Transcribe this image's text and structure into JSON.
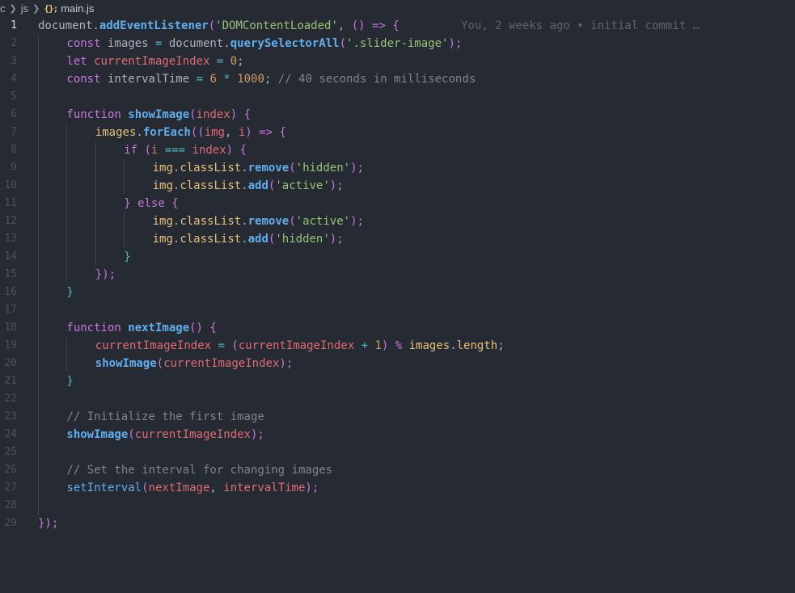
{
  "breadcrumb": {
    "items": [
      "c",
      "js"
    ],
    "file_icon": "{};",
    "file_name": "main.js"
  },
  "blame": "You, 2 weeks ago • initial commit …",
  "current_line": 1,
  "lines": [
    {
      "n": "1",
      "indent": 0,
      "tokens": [
        [
          "document",
          "t-plain"
        ],
        [
          ".",
          "t-plain"
        ],
        [
          "addEventListener",
          "t-fnb"
        ],
        [
          "(",
          "t-paren"
        ],
        [
          "'DOMContentLoaded'",
          "t-str"
        ],
        [
          ", ",
          "t-plain"
        ],
        [
          "() ",
          "t-paren"
        ],
        [
          "=>",
          "t-kw"
        ],
        [
          " {",
          "t-paren"
        ]
      ]
    },
    {
      "n": "2",
      "indent": 1,
      "tokens": [
        [
          "const",
          "t-kw"
        ],
        [
          " images ",
          "t-plain"
        ],
        [
          "=",
          "t-op"
        ],
        [
          " document",
          "t-plain"
        ],
        [
          ".",
          "t-plain"
        ],
        [
          "querySelectorAll",
          "t-fnb"
        ],
        [
          "(",
          "t-paren"
        ],
        [
          "'.slider-image'",
          "t-str"
        ],
        [
          ");",
          "t-paren"
        ]
      ]
    },
    {
      "n": "3",
      "indent": 1,
      "tokens": [
        [
          "let",
          "t-kw"
        ],
        [
          " ",
          "t-plain"
        ],
        [
          "currentImageIndex",
          "t-var"
        ],
        [
          " ",
          "t-plain"
        ],
        [
          "=",
          "t-op"
        ],
        [
          " ",
          "t-plain"
        ],
        [
          "0",
          "t-num"
        ],
        [
          ";",
          "t-plain"
        ]
      ]
    },
    {
      "n": "4",
      "indent": 1,
      "tokens": [
        [
          "const",
          "t-kw"
        ],
        [
          " intervalTime ",
          "t-plain"
        ],
        [
          "=",
          "t-op"
        ],
        [
          " ",
          "t-plain"
        ],
        [
          "6",
          "t-num"
        ],
        [
          " ",
          "t-plain"
        ],
        [
          "*",
          "t-op"
        ],
        [
          " ",
          "t-plain"
        ],
        [
          "1000",
          "t-num"
        ],
        [
          "; ",
          "t-plain"
        ],
        [
          "// 40 seconds in milliseconds",
          "t-com"
        ]
      ]
    },
    {
      "n": "5",
      "indent": 1,
      "tokens": []
    },
    {
      "n": "6",
      "indent": 1,
      "tokens": [
        [
          "function",
          "t-kw"
        ],
        [
          " ",
          "t-plain"
        ],
        [
          "showImage",
          "t-fnb"
        ],
        [
          "(",
          "t-paren"
        ],
        [
          "index",
          "t-var"
        ],
        [
          ") {",
          "t-paren"
        ]
      ]
    },
    {
      "n": "7",
      "indent": 2,
      "tokens": [
        [
          "images",
          "t-prop"
        ],
        [
          ".",
          "t-plain"
        ],
        [
          "forEach",
          "t-fnb"
        ],
        [
          "((",
          "t-paren"
        ],
        [
          "img",
          "t-var"
        ],
        [
          ", ",
          "t-plain"
        ],
        [
          "i",
          "t-var"
        ],
        [
          ") ",
          "t-paren"
        ],
        [
          "=>",
          "t-kw"
        ],
        [
          " {",
          "t-paren"
        ]
      ]
    },
    {
      "n": "8",
      "indent": 3,
      "tokens": [
        [
          "if",
          "t-kw"
        ],
        [
          " (",
          "t-paren"
        ],
        [
          "i",
          "t-var"
        ],
        [
          " ",
          "t-plain"
        ],
        [
          "===",
          "t-op"
        ],
        [
          " ",
          "t-plain"
        ],
        [
          "index",
          "t-var"
        ],
        [
          ") {",
          "t-paren"
        ]
      ]
    },
    {
      "n": "9",
      "indent": 4,
      "tokens": [
        [
          "img",
          "t-prop"
        ],
        [
          ".",
          "t-plain"
        ],
        [
          "classList",
          "t-prop"
        ],
        [
          ".",
          "t-plain"
        ],
        [
          "remove",
          "t-fnb"
        ],
        [
          "(",
          "t-paren"
        ],
        [
          "'hidden'",
          "t-str"
        ],
        [
          ");",
          "t-paren"
        ]
      ]
    },
    {
      "n": "10",
      "indent": 4,
      "tokens": [
        [
          "img",
          "t-prop"
        ],
        [
          ".",
          "t-plain"
        ],
        [
          "classList",
          "t-prop"
        ],
        [
          ".",
          "t-plain"
        ],
        [
          "add",
          "t-fnb"
        ],
        [
          "(",
          "t-paren"
        ],
        [
          "'active'",
          "t-str"
        ],
        [
          ");",
          "t-paren"
        ]
      ]
    },
    {
      "n": "11",
      "indent": 3,
      "tokens": [
        [
          "} ",
          "t-paren"
        ],
        [
          "else",
          "t-kw"
        ],
        [
          " {",
          "t-paren"
        ]
      ]
    },
    {
      "n": "12",
      "indent": 4,
      "tokens": [
        [
          "img",
          "t-prop"
        ],
        [
          ".",
          "t-plain"
        ],
        [
          "classList",
          "t-prop"
        ],
        [
          ".",
          "t-plain"
        ],
        [
          "remove",
          "t-fnb"
        ],
        [
          "(",
          "t-paren"
        ],
        [
          "'active'",
          "t-str"
        ],
        [
          ");",
          "t-paren"
        ]
      ]
    },
    {
      "n": "13",
      "indent": 4,
      "tokens": [
        [
          "img",
          "t-prop"
        ],
        [
          ".",
          "t-plain"
        ],
        [
          "classList",
          "t-prop"
        ],
        [
          ".",
          "t-plain"
        ],
        [
          "add",
          "t-fnb"
        ],
        [
          "(",
          "t-paren"
        ],
        [
          "'hidden'",
          "t-str"
        ],
        [
          ");",
          "t-paren"
        ]
      ]
    },
    {
      "n": "14",
      "indent": 3,
      "tokens": [
        [
          "}",
          "t-op"
        ]
      ]
    },
    {
      "n": "15",
      "indent": 2,
      "tokens": [
        [
          "});",
          "t-paren"
        ]
      ]
    },
    {
      "n": "16",
      "indent": 1,
      "tokens": [
        [
          "}",
          "t-op"
        ]
      ]
    },
    {
      "n": "17",
      "indent": 1,
      "tokens": []
    },
    {
      "n": "18",
      "indent": 1,
      "tokens": [
        [
          "function",
          "t-kw"
        ],
        [
          " ",
          "t-plain"
        ],
        [
          "nextImage",
          "t-fnb"
        ],
        [
          "() {",
          "t-paren"
        ]
      ]
    },
    {
      "n": "19",
      "indent": 2,
      "tokens": [
        [
          "currentImageIndex",
          "t-var"
        ],
        [
          " ",
          "t-plain"
        ],
        [
          "=",
          "t-op"
        ],
        [
          " (",
          "t-paren"
        ],
        [
          "currentImageIndex",
          "t-var"
        ],
        [
          " ",
          "t-plain"
        ],
        [
          "+",
          "t-op"
        ],
        [
          " ",
          "t-plain"
        ],
        [
          "1",
          "t-num"
        ],
        [
          ") ",
          "t-paren"
        ],
        [
          "%",
          "t-kw"
        ],
        [
          " ",
          "t-plain"
        ],
        [
          "images",
          "t-prop"
        ],
        [
          ".",
          "t-plain"
        ],
        [
          "length",
          "t-prop"
        ],
        [
          ";",
          "t-plain"
        ]
      ]
    },
    {
      "n": "20",
      "indent": 2,
      "tokens": [
        [
          "showImage",
          "t-fnb"
        ],
        [
          "(",
          "t-paren"
        ],
        [
          "currentImageIndex",
          "t-var"
        ],
        [
          ");",
          "t-paren"
        ]
      ]
    },
    {
      "n": "21",
      "indent": 1,
      "tokens": [
        [
          "}",
          "t-op"
        ]
      ]
    },
    {
      "n": "22",
      "indent": 1,
      "tokens": []
    },
    {
      "n": "23",
      "indent": 1,
      "tokens": [
        [
          "// Initialize the first image",
          "t-com"
        ]
      ]
    },
    {
      "n": "24",
      "indent": 1,
      "tokens": [
        [
          "showImage",
          "t-fnb"
        ],
        [
          "(",
          "t-paren"
        ],
        [
          "currentImageIndex",
          "t-var"
        ],
        [
          ");",
          "t-paren"
        ]
      ]
    },
    {
      "n": "25",
      "indent": 1,
      "tokens": []
    },
    {
      "n": "26",
      "indent": 1,
      "tokens": [
        [
          "// Set the interval for changing images",
          "t-com"
        ]
      ]
    },
    {
      "n": "27",
      "indent": 1,
      "tokens": [
        [
          "setInterval",
          "t-fn"
        ],
        [
          "(",
          "t-paren"
        ],
        [
          "nextImage",
          "t-var"
        ],
        [
          ", ",
          "t-plain"
        ],
        [
          "intervalTime",
          "t-var"
        ],
        [
          ");",
          "t-paren"
        ]
      ]
    },
    {
      "n": "28",
      "indent": 1,
      "tokens": []
    },
    {
      "n": "29",
      "indent": 0,
      "tokens": [
        [
          "});",
          "t-paren"
        ]
      ]
    }
  ],
  "colors": {
    "background": "#262a33",
    "keyword": "#c678dd",
    "function": "#61afef",
    "string": "#98c379",
    "number": "#d19a66",
    "variable": "#e06c75",
    "comment": "#7f848e"
  }
}
